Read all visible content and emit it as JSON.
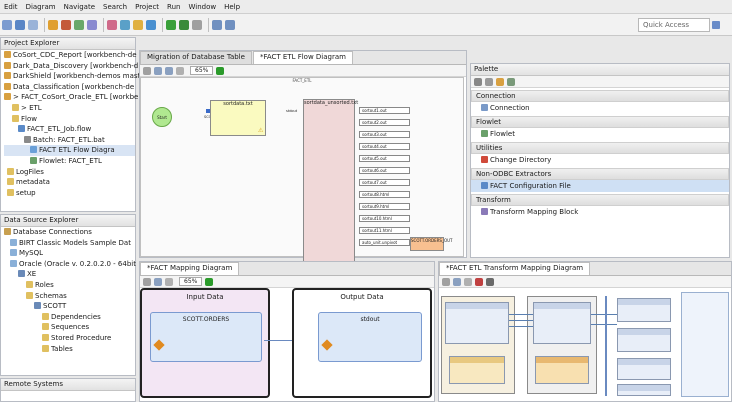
{
  "menu": [
    "Edit",
    "Diagram",
    "Navigate",
    "Search",
    "Project",
    "Run",
    "Window",
    "Help"
  ],
  "toolbar": {
    "quick_access": "Quick Access"
  },
  "project_explorer": {
    "title": "Project Explorer",
    "items": [
      "CoSort_CDC_Report [workbench-de",
      "Dark_Data_Discovery [workbench-d",
      "DarkShield [workbench-demos mast",
      "Data_Classification [workbench-de",
      "> FACT_CoSort_Oracle_ETL [workbe",
      "> ETL",
      "Flow",
      "FACT_ETL_Job.flow",
      "Batch: FACT_ETL.bat",
      "FACT ETL Flow Diagra",
      "Flowlet: FACT_ETL",
      "LogFiles",
      "metadata",
      "setup"
    ]
  },
  "data_source_explorer": {
    "title": "Data Source Explorer",
    "items": [
      "Database Connections",
      "BIRT Classic Models Sample Dat",
      "MySQL",
      "Oracle (Oracle v. 0.2.0.2.0 - 64bit",
      "XE",
      "Roles",
      "Schemas",
      "SCOTT",
      "Dependencies",
      "Sequences",
      "Stored Procedure",
      "Tables"
    ]
  },
  "remote_systems": {
    "title": "Remote Systems"
  },
  "editor": {
    "tabs": [
      "Migration of Database Table",
      "*FACT ETL Flow Diagram"
    ],
    "zoom": "65%",
    "header": "FACT_ETL",
    "start": "Start",
    "conn_label": "SCOTT.ORDERS",
    "sort_box": "sortdata.txt",
    "split_box": "sortdata_unsorted.txt",
    "out_port_label": "stdout",
    "outputs": [
      "sortout1.out",
      "sortout2.out",
      "sortout3.out",
      "sortout4.out",
      "sortout5.out",
      "sortout6.out",
      "sortout7.out",
      "sortout8.html",
      "sortout9.html",
      "sortout10.html",
      "sortout11.html",
      "auto_unit.unpivot"
    ],
    "target": "SCOTT.ORDERS_OUT"
  },
  "palette": {
    "title": "Palette",
    "sections": [
      {
        "header": "Connection",
        "items": [
          "Connection"
        ]
      },
      {
        "header": "Flowlet",
        "items": [
          "Flowlet"
        ]
      },
      {
        "header": "Utilities",
        "items": [
          "Change Directory"
        ]
      },
      {
        "header": "Non-ODBC Extractors",
        "items": [
          "FACT Configuration File"
        ]
      },
      {
        "header": "Transform",
        "items": [
          "Transform Mapping Block"
        ]
      }
    ]
  },
  "mapping": {
    "tab": "*FACT Mapping Diagram",
    "zoom": "65%",
    "input_title": "Input Data",
    "output_title": "Output Data",
    "input_table": "SCOTT.ORDERS",
    "output_table": "stdout"
  },
  "transform": {
    "tab": "*FACT ETL Transform Mapping Diagram"
  }
}
